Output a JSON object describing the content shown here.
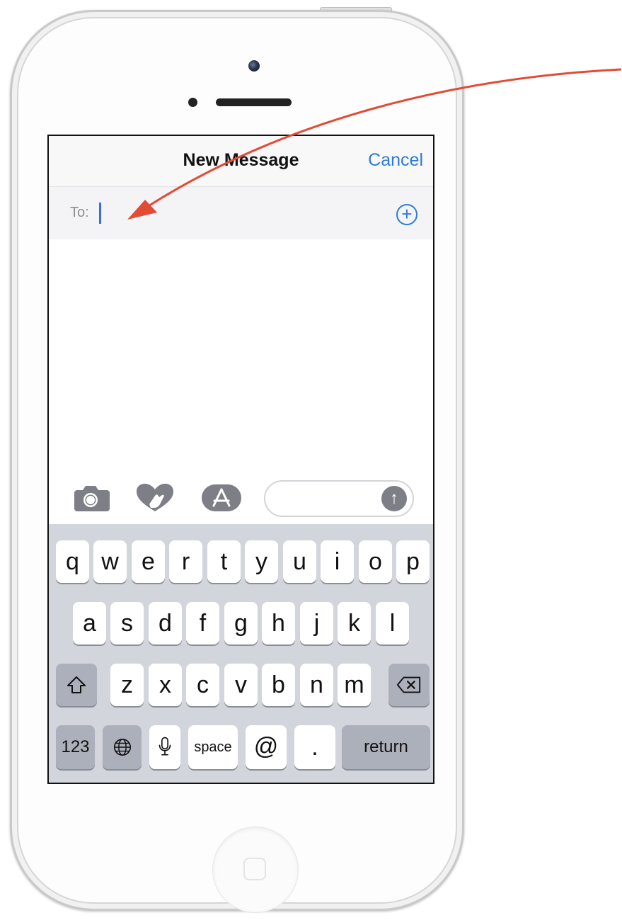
{
  "nav": {
    "title": "New Message",
    "cancel": "Cancel"
  },
  "to_field": {
    "label": "To:",
    "value": "",
    "add_symbol": "+"
  },
  "compose": {
    "camera_icon": "camera-icon",
    "digital_touch_icon": "digital-touch-heart-icon",
    "appstore_icon": "app-store-icon",
    "message_value": "",
    "send_symbol": "↑"
  },
  "keyboard": {
    "row1": [
      "q",
      "w",
      "e",
      "r",
      "t",
      "y",
      "u",
      "i",
      "o",
      "p"
    ],
    "row2": [
      "a",
      "s",
      "d",
      "f",
      "g",
      "h",
      "j",
      "k",
      "l"
    ],
    "row3": [
      "z",
      "x",
      "c",
      "v",
      "b",
      "n",
      "m"
    ],
    "numbers": "123",
    "space": "space",
    "at": "@",
    "period": ".",
    "return": "return"
  },
  "colors": {
    "accent": "#2f7bd6",
    "annotation_arrow": "#e24b35",
    "keyboard_bg": "#d2d5dc",
    "function_key": "#abb0bb"
  }
}
